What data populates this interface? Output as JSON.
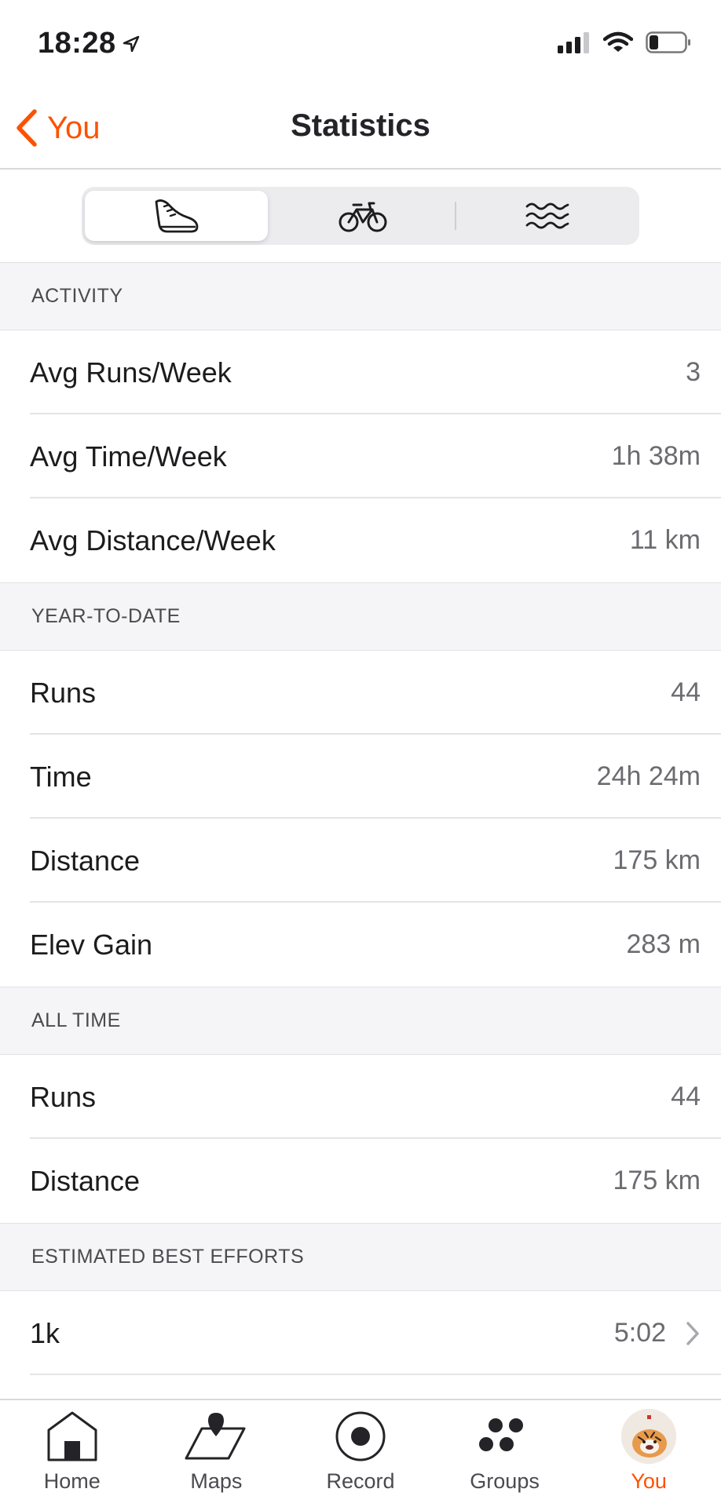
{
  "status_bar": {
    "time": "18:28"
  },
  "nav": {
    "back_label": "You",
    "title": "Statistics"
  },
  "segments": [
    {
      "icon": "running-shoe-icon",
      "active": true
    },
    {
      "icon": "bicycle-icon",
      "active": false
    },
    {
      "icon": "swim-waves-icon",
      "active": false
    }
  ],
  "sections": {
    "activity": {
      "header": "ACTIVITY",
      "rows": [
        {
          "label": "Avg Runs/Week",
          "value": "3"
        },
        {
          "label": "Avg Time/Week",
          "value": "1h 38m"
        },
        {
          "label": "Avg Distance/Week",
          "value": "11 km"
        }
      ]
    },
    "ytd": {
      "header": "YEAR-TO-DATE",
      "rows": [
        {
          "label": "Runs",
          "value": "44"
        },
        {
          "label": "Time",
          "value": "24h 24m"
        },
        {
          "label": "Distance",
          "value": "175 km"
        },
        {
          "label": "Elev Gain",
          "value": "283 m"
        }
      ]
    },
    "all_time": {
      "header": "ALL TIME",
      "rows": [
        {
          "label": "Runs",
          "value": "44"
        },
        {
          "label": "Distance",
          "value": "175 km"
        }
      ]
    },
    "best_efforts": {
      "header": "ESTIMATED BEST EFFORTS",
      "rows": [
        {
          "label": "1k",
          "value": "5:02"
        }
      ]
    }
  },
  "tabs": [
    {
      "label": "Home",
      "icon": "home-icon"
    },
    {
      "label": "Maps",
      "icon": "map-icon"
    },
    {
      "label": "Record",
      "icon": "record-icon"
    },
    {
      "label": "Groups",
      "icon": "groups-icon"
    },
    {
      "label": "You",
      "icon": "avatar",
      "active": true
    }
  ],
  "colors": {
    "accent": "#fc5200",
    "section_bg": "#f5f5f8",
    "value_text": "#6b6b70"
  }
}
